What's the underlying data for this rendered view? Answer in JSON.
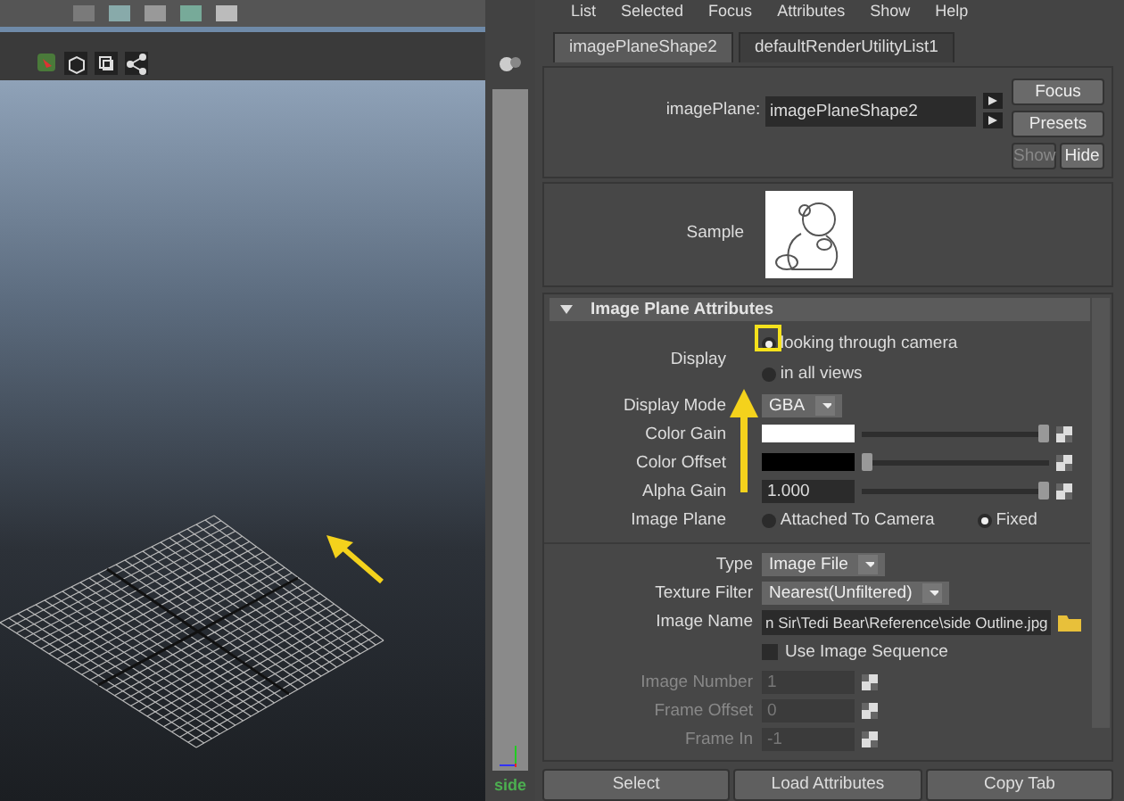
{
  "viewport": {
    "camera_label": "side"
  },
  "menu": [
    "List",
    "Selected",
    "Focus",
    "Attributes",
    "Show",
    "Help"
  ],
  "tabs": [
    {
      "label": "imagePlaneShape2",
      "selected": true
    },
    {
      "label": "defaultRenderUtilityList1",
      "selected": false
    }
  ],
  "image_plane": {
    "label": "imagePlane:",
    "value": "imagePlaneShape2",
    "buttons": [
      {
        "label": "Focus",
        "disabled": false
      },
      {
        "label": "Presets",
        "disabled": false
      }
    ],
    "small_buttons": [
      {
        "label": "Show",
        "disabled": true
      },
      {
        "label": "Hide",
        "disabled": false
      }
    ]
  },
  "sample": {
    "label": "Sample"
  },
  "section": {
    "title": "Image Plane Attributes",
    "expanded": true
  },
  "display_attributes": [
    {
      "kind": "radio_stack",
      "label": "Display",
      "disabled": false,
      "options": [
        {
          "label": "looking through camera",
          "selected": true
        },
        {
          "label": "in all views",
          "selected": false
        }
      ]
    },
    {
      "kind": "dropdown",
      "label": "Display Mode",
      "disabled": false,
      "value": "GBA"
    },
    {
      "kind": "color_slider",
      "label": "Color Gain",
      "disabled": false,
      "color": "#ffffff",
      "level": 1
    },
    {
      "kind": "color_slider",
      "label": "Color Offset",
      "disabled": false,
      "color": "#000000",
      "level": 0
    },
    {
      "kind": "number_slider",
      "label": "Alpha Gain",
      "disabled": false,
      "value": "1.000",
      "level": 1
    },
    {
      "kind": "radio_row",
      "label": "Image Plane",
      "disabled": false,
      "options": [
        {
          "label": "Attached To Camera",
          "selected": false
        },
        {
          "label": "Fixed",
          "selected": true
        }
      ]
    }
  ],
  "file_attributes": [
    {
      "kind": "dropdown",
      "label": "Type",
      "disabled": false,
      "value": "Image File"
    },
    {
      "kind": "dropdown",
      "label": "Texture Filter",
      "disabled": false,
      "value": "Nearest(Unfiltered)"
    },
    {
      "kind": "file_field",
      "label": "Image Name",
      "disabled": false,
      "value": "n Sir\\Tedi Bear\\Reference\\side Outline.jpg"
    },
    {
      "kind": "checkbox",
      "label": "Use Image Sequence",
      "disabled": false,
      "checked": false
    },
    {
      "kind": "number_field",
      "label": "Image Number",
      "disabled": true,
      "value": "1"
    },
    {
      "kind": "number_field",
      "label": "Frame Offset",
      "disabled": true,
      "value": "0"
    },
    {
      "kind": "number_field",
      "label": "Frame In",
      "disabled": true,
      "value": "-1"
    }
  ],
  "bottom_buttons": [
    "Select",
    "Load Attributes",
    "Copy Tab"
  ]
}
